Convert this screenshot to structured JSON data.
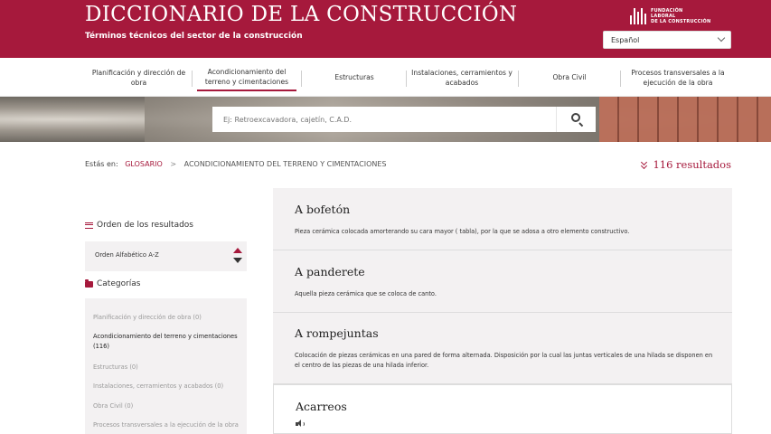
{
  "header": {
    "title": "DICCIONARIO DE LA CONSTRUCCIÓN",
    "subtitle": "Términos técnicos del sector de la construcción",
    "logo_lines": [
      "FUNDACIÓN",
      "LABORAL",
      "DE LA CONSTRUCCIÓN"
    ],
    "language": "Español"
  },
  "nav": {
    "items": [
      {
        "label": "Planificación y dirección de obra"
      },
      {
        "label": "Acondicionamiento del terreno y cimentaciones"
      },
      {
        "label": "Estructuras"
      },
      {
        "label": "Instalaciones, cerramientos y acabados"
      },
      {
        "label": "Obra Civil"
      },
      {
        "label": "Procesos transversales a la ejecución de la obra"
      }
    ],
    "active_index": 1
  },
  "search": {
    "placeholder": "Ej: Retroexcavadora, cajetín, C.A.D.",
    "button_icon": "search-icon"
  },
  "breadcrumb": {
    "label": "Estás en:",
    "link": "GLOSARIO",
    "separator": ">",
    "current": "ACONDICIONAMIENTO DEL TERRENO Y CIMENTACIONES"
  },
  "results_count": "116 resultados",
  "sidebar": {
    "order_title": "Orden de los resultados",
    "order_value": "Orden Alfabético A-Z",
    "categories_title": "Categorías",
    "categories": [
      {
        "label": "Planificación y dirección de obra (0)",
        "active": false
      },
      {
        "label": "Acondicionamiento del terreno y cimentaciones (116)",
        "active": true
      },
      {
        "label": "Estructuras (0)",
        "active": false
      },
      {
        "label": "Instalaciones, cerramientos y acabados (0)",
        "active": false
      },
      {
        "label": "Obra Civil (0)",
        "active": false
      },
      {
        "label": "Procesos transversales a la ejecución de la obra",
        "active": false
      }
    ]
  },
  "results": [
    {
      "term": "A bofetón",
      "definition": "Pieza cerámica colocada amorterando su cara mayor ( tabla), por la que se adosa a otro elemento constructivo."
    },
    {
      "term": "A panderete",
      "definition": "Aquella pieza cerámica que se coloca de canto."
    },
    {
      "term": "A rompejuntas",
      "definition": "Colocación de piezas cerámicas en una pared de forma alternada. Disposición por la cual las juntas verticales de una hilada se disponen en el centro de las piezas de una hilada inferior."
    },
    {
      "term": "Acarreos",
      "definition": ""
    }
  ],
  "colors": {
    "brand": "#a6193c",
    "panel": "#f3f1f2"
  }
}
